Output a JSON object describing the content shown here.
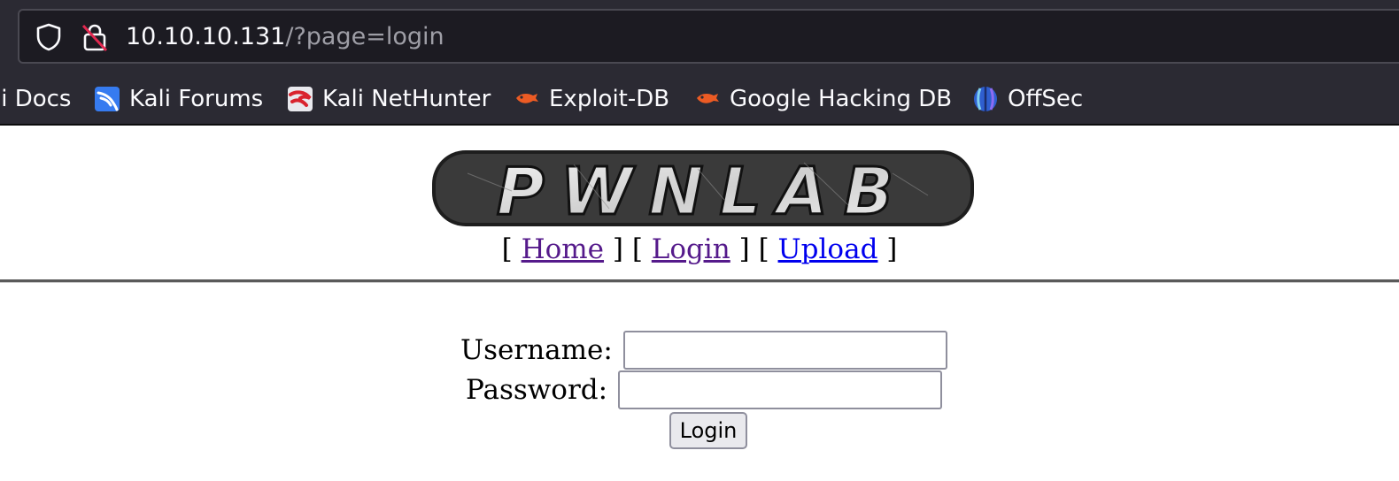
{
  "browser": {
    "url_host": "10.10.10.131",
    "url_path": "/?page=login",
    "bookmarks": [
      {
        "label": "li Docs",
        "icon": "kali-docs-icon"
      },
      {
        "label": "Kali Forums",
        "icon": "kali-forums-icon"
      },
      {
        "label": "Kali NetHunter",
        "icon": "kali-nethunter-icon"
      },
      {
        "label": "Exploit-DB",
        "icon": "exploit-db-icon"
      },
      {
        "label": "Google Hacking DB",
        "icon": "ghdb-icon"
      },
      {
        "label": "OffSec",
        "icon": "offsec-icon"
      }
    ]
  },
  "page": {
    "logo_text": "PWNLAB",
    "nav": {
      "open": "[",
      "sep": "] [",
      "close": "]",
      "home": "Home",
      "login": "Login",
      "upload": "Upload"
    },
    "form": {
      "username_label": "Username:",
      "password_label": "Password:",
      "username_value": "",
      "password_value": "",
      "submit_label": "Login"
    }
  }
}
